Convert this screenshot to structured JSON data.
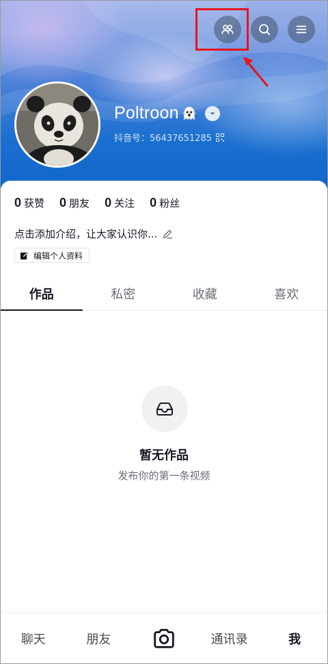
{
  "header": {
    "username": "Poltroon",
    "douyin_id": "抖音号：56437651285",
    "buttons": [
      {
        "name": "friends-icon"
      },
      {
        "name": "search-icon"
      },
      {
        "name": "menu-icon"
      }
    ],
    "accent_highlight": "#e8141a"
  },
  "stats": [
    {
      "num": "0",
      "label": "获赞"
    },
    {
      "num": "0",
      "label": "朋友"
    },
    {
      "num": "0",
      "label": "关注"
    },
    {
      "num": "0",
      "label": "粉丝"
    }
  ],
  "bio": {
    "placeholder": "点击添加介绍，让大家认识你..."
  },
  "edit_profile": {
    "label": "编辑个人资料"
  },
  "tabs": [
    {
      "label": "作品",
      "active": true
    },
    {
      "label": "私密",
      "active": false
    },
    {
      "label": "收藏",
      "active": false
    },
    {
      "label": "喜欢",
      "active": false
    }
  ],
  "empty_state": {
    "title": "暂无作品",
    "subtitle": "发布你的第一条视频"
  },
  "bottom_nav": [
    {
      "label": "聊天",
      "active": false
    },
    {
      "label": "朋友",
      "active": false
    },
    {
      "label": "",
      "icon": "camera-icon"
    },
    {
      "label": "通讯录",
      "active": false
    },
    {
      "label": "我",
      "active": true
    }
  ]
}
